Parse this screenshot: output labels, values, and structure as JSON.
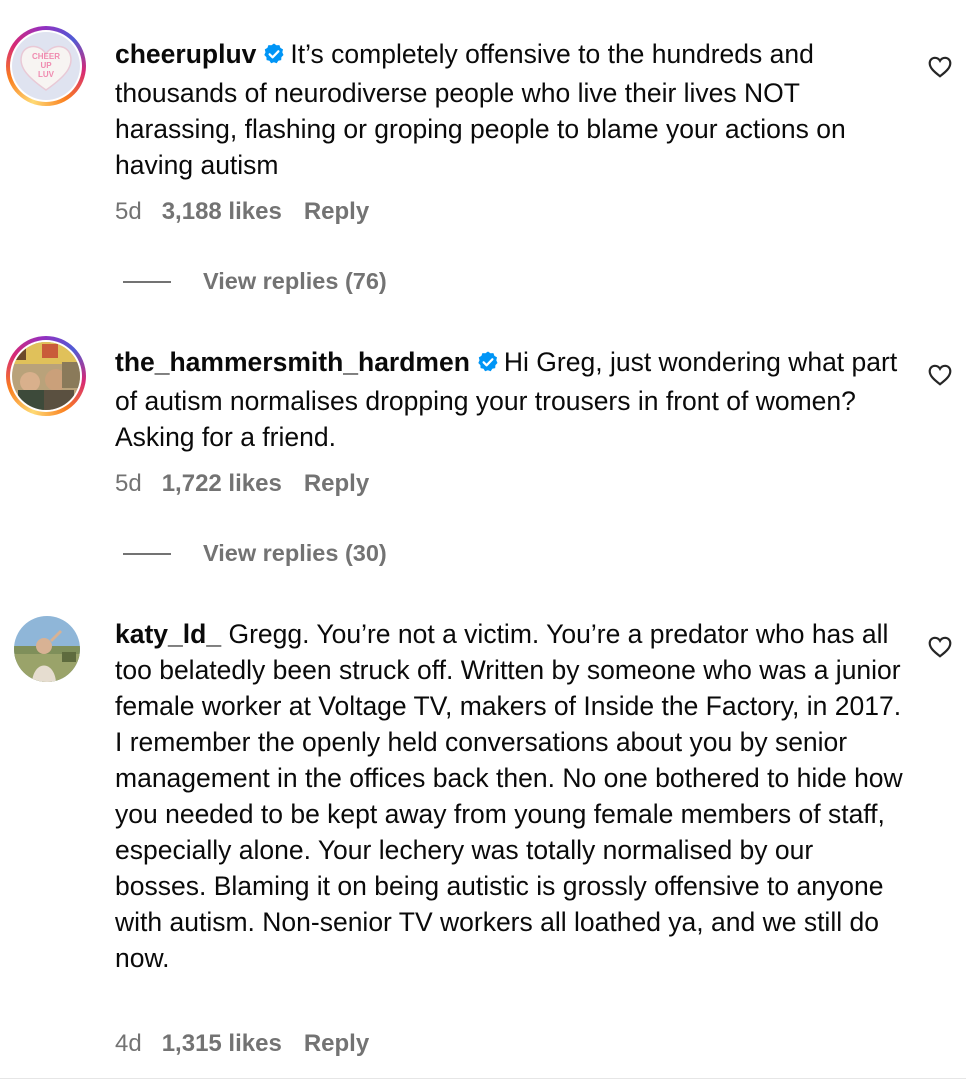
{
  "comments": [
    {
      "username": "cheerupluv",
      "verified": true,
      "text": "It’s completely offensive to the hundreds and thousands of neurodiverse people who live their lives NOT harassing, flashing or groping people to blame your actions on having autism",
      "age": "5d",
      "likes": "3,188 likes",
      "reply_label": "Reply",
      "view_replies": "View replies (76)",
      "avatar_text": [
        "CHEER",
        "UP",
        "LUV"
      ]
    },
    {
      "username": "the_hammersmith_hardmen",
      "verified": true,
      "text": "Hi Greg, just wondering what part of autism normalises dropping your trousers in front of women? Asking for a friend.",
      "age": "5d",
      "likes": "1,722 likes",
      "reply_label": "Reply",
      "view_replies": "View replies (30)"
    },
    {
      "username": "katy_ld_",
      "verified": false,
      "text": "Gregg. You’re not a victim. You’re a predator who has all too belatedly been struck off. Written by someone who was a junior female worker at Voltage TV, makers of Inside the Factory, in 2017. I remember the openly held conversations about you by senior management in the offices back then. No one bothered to hide how you needed to be kept away from young female members of staff, especially alone. Your lechery was totally normalised by our bosses. Blaming it on being autistic is grossly offensive to anyone with autism. Non-senior TV workers all loathed ya, and we still do now.",
      "age": "4d",
      "likes": "1,315 likes",
      "reply_label": "Reply"
    }
  ],
  "colors": {
    "verified_blue": "#0095f6",
    "secondary_text": "#737373"
  },
  "icons": {
    "like": "heart-outline-icon",
    "verified": "verified-badge-icon"
  }
}
